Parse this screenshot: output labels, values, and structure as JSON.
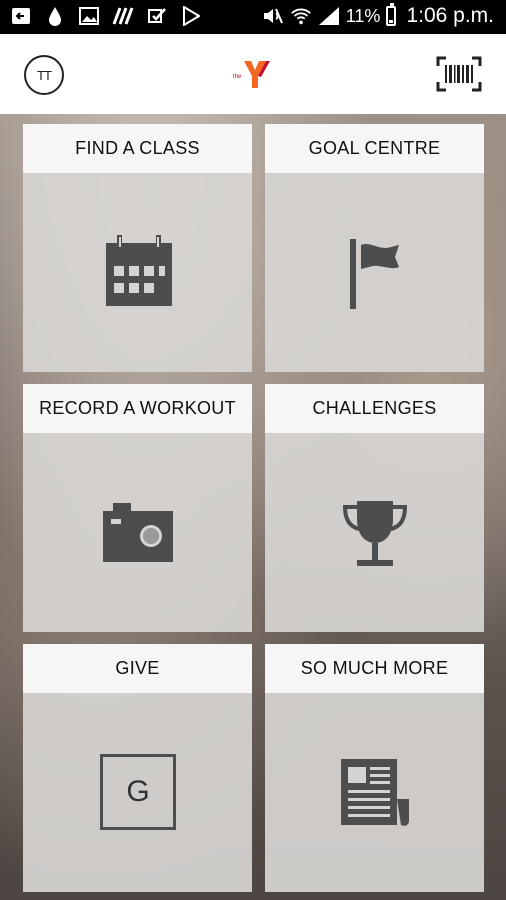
{
  "status_bar": {
    "battery": "11%",
    "time": "1:06 p.m.",
    "icons": [
      "back-arrow-icon",
      "water-drop-icon",
      "image-icon",
      "fitness-app-icon",
      "mail-check-icon",
      "play-store-icon",
      "mute-icon",
      "wifi-icon",
      "signal-icon",
      "battery-icon"
    ]
  },
  "app_bar": {
    "avatar_initials": "TT",
    "logo": "the Y logo",
    "barcode": "barcode-scan-icon"
  },
  "tiles": [
    {
      "label": "FIND A CLASS",
      "icon": "calendar-icon"
    },
    {
      "label": "GOAL CENTRE",
      "icon": "flag-icon"
    },
    {
      "label": "RECORD A WORKOUT",
      "icon": "camera-icon"
    },
    {
      "label": "CHALLENGES",
      "icon": "trophy-icon"
    },
    {
      "label": "GIVE",
      "icon": "give-g-icon",
      "icon_text": "G"
    },
    {
      "label": "SO MUCH MORE",
      "icon": "newspaper-icon"
    }
  ],
  "colors": {
    "brand_y": "#f26722",
    "brand_y_alt": "#c8102e",
    "icon_gray": "#4d4d4d"
  }
}
